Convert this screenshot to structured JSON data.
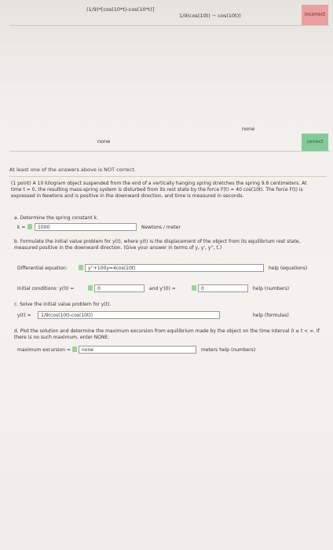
{
  "results": {
    "rows": [
      {
        "entered": "(1/9)*[cos(10*t)-cos(10*t)]",
        "preview": "1/9(cos(10t) − cos(10t))",
        "status": "incorrect"
      },
      {
        "entered": "none",
        "preview": "none",
        "status": "correct"
      }
    ]
  },
  "banner": "At least one of the answers above is NOT correct.",
  "problem": {
    "intro": "(1 point) A 10 kilogram object suspended from the end of a vertically hanging spring stretches the spring 9.8 centimeters. At time t = 0, the resulting mass-spring system is disturbed from its rest state by the force F(t) = 40 cos(10t). The force F(t) is expressed in Newtons and is positive in the downward direction, and time is measured in seconds.",
    "part_a": "a. Determine the spring constant k.",
    "k_label": "k =",
    "k_value": "1000",
    "k_units": "Newtons / meter",
    "part_b": "b. Formulate the initial value problem for y(t), where y(t) is the displacement of the object from its equilibrium rest state, measured positive in the downward direction. (Give your answer in terms of y, y', y'', t.)",
    "de_label": "Differential equation:",
    "de_value": "y''+100y=4cos(10t)",
    "de_help": "help (equations)",
    "ic_label": "Initial conditions: y(0) =",
    "ic_y0": "0",
    "ic_and": "and y'(0) =",
    "ic_yp0": "0",
    "ic_help": "help (numbers)",
    "part_c": "c. Solve the initial value problem for y(t).",
    "sol_label": "y(t) =",
    "sol_value": "1/9(cos(10t)-cos(10t))",
    "sol_help": "help (formulas)",
    "part_d": "d. Plot the solution and determine the maximum excursion from equilibrium made by the object on the time interval 0 ≤ t < ∞. If there is no such maximum, enter NONE.",
    "max_label": "maximum excursion =",
    "max_value": "none",
    "max_help": "meters help (numbers)"
  }
}
